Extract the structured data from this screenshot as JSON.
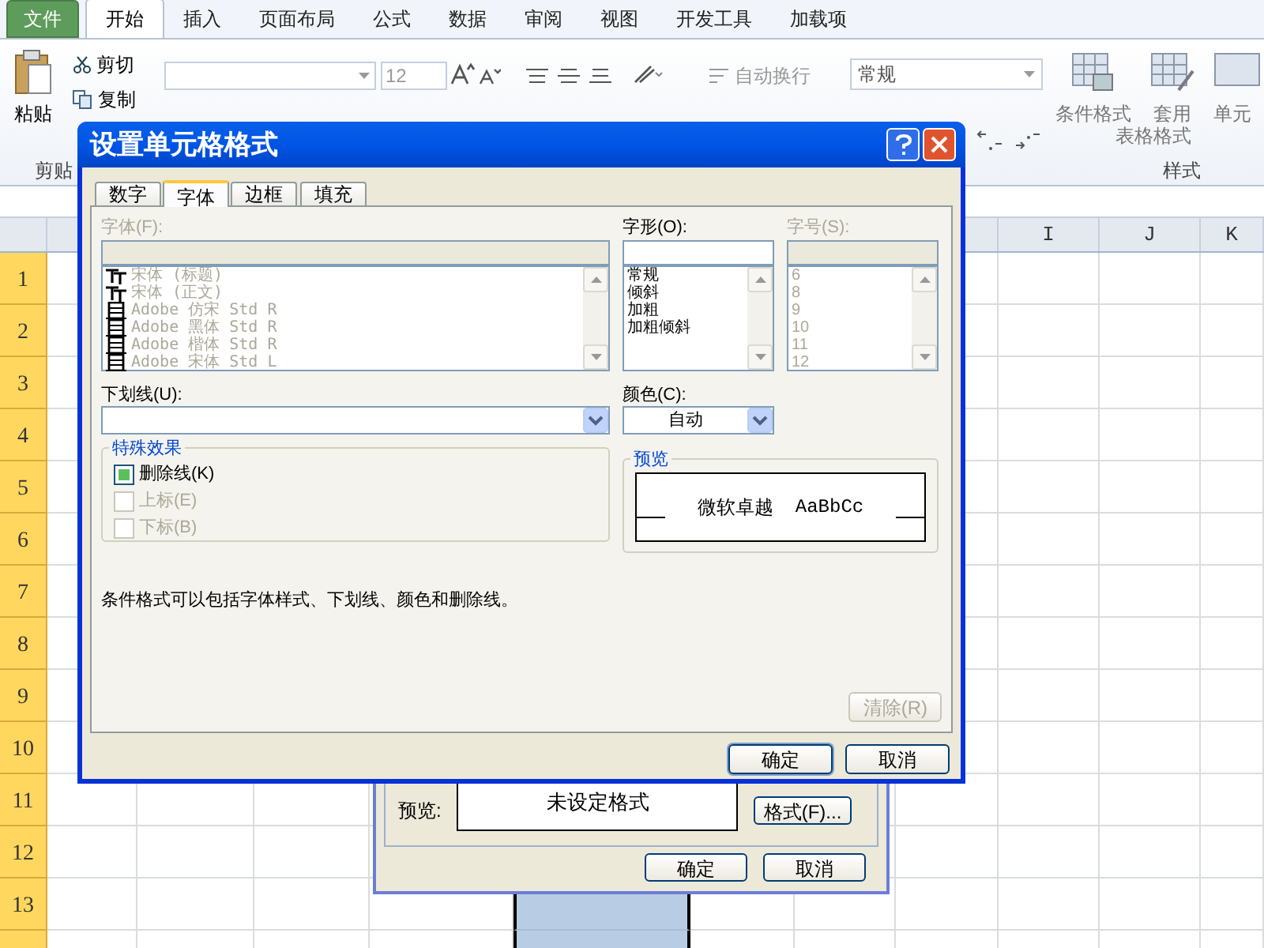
{
  "ribbon_tabs": [
    {
      "label": "文件",
      "kind": "file",
      "selected": false
    },
    {
      "label": "开始",
      "kind": "tab",
      "selected": true
    },
    {
      "label": "插入",
      "kind": "tab",
      "selected": false
    },
    {
      "label": "页面布局",
      "kind": "tab",
      "selected": false
    },
    {
      "label": "公式",
      "kind": "tab",
      "selected": false
    },
    {
      "label": "数据",
      "kind": "tab",
      "selected": false
    },
    {
      "label": "审阅",
      "kind": "tab",
      "selected": false
    },
    {
      "label": "视图",
      "kind": "tab",
      "selected": false
    },
    {
      "label": "开发工具",
      "kind": "tab",
      "selected": false
    },
    {
      "label": "加载项",
      "kind": "tab",
      "selected": false
    }
  ],
  "ribbon": {
    "paste": "粘贴",
    "cut": "剪切",
    "copy": "复制",
    "clipboard_group": "剪贴",
    "font_size": "12",
    "wrap_text": "自动换行",
    "number_format": "常规",
    "conditional_format": "条件格式",
    "table_format_1": "套用",
    "table_format_2": "表格格式",
    "cell_styles": "单元",
    "styles_group": "样式"
  },
  "sheet": {
    "column_headers": [
      "I",
      "J",
      "K"
    ],
    "row_headers": [
      "1",
      "2",
      "3",
      "4",
      "5",
      "6",
      "7",
      "8",
      "9",
      "10",
      "11",
      "12",
      "13"
    ]
  },
  "dialog": {
    "title": "设置单元格格式",
    "tabs": [
      {
        "label": "数字",
        "selected": false
      },
      {
        "label": "字体",
        "selected": true
      },
      {
        "label": "边框",
        "selected": false
      },
      {
        "label": "填充",
        "selected": false
      }
    ],
    "font": {
      "label": "字体(F):",
      "disabled": true,
      "items": [
        {
          "name": "宋体 (标题)",
          "kind": "theme"
        },
        {
          "name": "宋体 (正文)",
          "kind": "theme"
        },
        {
          "name": "Adobe 仿宋 Std R",
          "kind": "opentype"
        },
        {
          "name": "Adobe 黑体 Std R",
          "kind": "opentype"
        },
        {
          "name": "Adobe 楷体 Std R",
          "kind": "opentype"
        },
        {
          "name": "Adobe 宋体 Std L",
          "kind": "opentype"
        }
      ]
    },
    "style": {
      "label": "字形(O):",
      "disabled": false,
      "items": [
        {
          "name": "常规"
        },
        {
          "name": "倾斜"
        },
        {
          "name": "加粗"
        },
        {
          "name": "加粗倾斜"
        }
      ]
    },
    "size": {
      "label": "字号(S):",
      "disabled": true,
      "items": [
        {
          "name": "6"
        },
        {
          "name": "8"
        },
        {
          "name": "9"
        },
        {
          "name": "10"
        },
        {
          "name": "11"
        },
        {
          "name": "12"
        }
      ]
    },
    "underline": {
      "label": "下划线(U):"
    },
    "color": {
      "label": "颜色(C):",
      "value": "自动"
    },
    "effects": {
      "title": "特殊效果",
      "items": [
        {
          "label": "删除线(K)",
          "checked": false,
          "mixed": true,
          "disabled": false
        },
        {
          "label": "上标(E)",
          "checked": false,
          "mixed": false,
          "disabled": true
        },
        {
          "label": "下标(B)",
          "checked": false,
          "mixed": false,
          "disabled": true
        }
      ]
    },
    "preview": {
      "title": "预览",
      "sample_1": "微软卓越",
      "sample_2": "AaBbCc"
    },
    "note": "条件格式可以包括字体样式、下划线、颜色和删除线。",
    "clear_button": {
      "label": "清除(R)",
      "disabled": true
    },
    "buttons": [
      "确定",
      "取消"
    ]
  },
  "rule_dialog": {
    "preview_label": "预览:",
    "preview_text": "未设定格式",
    "format_button": "格式(F)...",
    "buttons": [
      "确定",
      "取消"
    ]
  }
}
